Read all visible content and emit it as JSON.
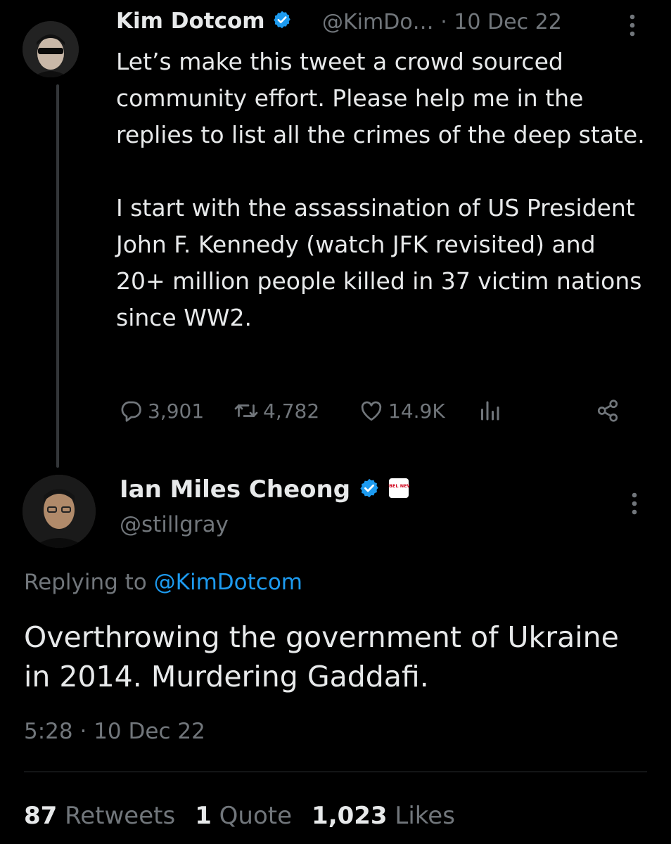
{
  "parent_tweet": {
    "author_name": "Kim Dotcom",
    "handle": "@KimDo…",
    "separator": "·",
    "date": "10 Dec 22",
    "text_paragraphs": [
      "Let’s make this tweet a crowd sourced community effort. Please help me in the replies to list all the crimes of the deep state.",
      "I start with the assassination of US President John F. Kennedy (watch JFK revisited) and 20+ million people killed in 37 victim nations since WW2."
    ],
    "actions": {
      "replies": "3,901",
      "retweets": "4,782",
      "likes": "14.9K"
    }
  },
  "reply_tweet": {
    "author_name": "Ian Miles Cheong",
    "handle": "@stillgray",
    "affiliation_badge_text": "REBEL NEWS",
    "replying_label": "Replying to",
    "replying_to": "@KimDotcom",
    "text": "Overthrowing the government of Ukraine in 2014. Murdering Gaddafi.",
    "time": "5:28",
    "separator": "·",
    "date": "10 Dec 22",
    "stats": {
      "retweets_count": "87",
      "retweets_label": "Retweets",
      "quotes_count": "1",
      "quotes_label": "Quote",
      "likes_count": "1,023",
      "likes_label": "Likes"
    }
  },
  "colors": {
    "background": "#000000",
    "text_primary": "#e7e9ea",
    "text_secondary": "#71767b",
    "link_blue": "#1d9bf0",
    "verified_blue": "#1d9bf0",
    "divider": "#2f3336"
  },
  "icons": [
    "verified-badge-icon",
    "more-options-icon",
    "reply-icon",
    "retweet-icon",
    "like-icon",
    "views-icon",
    "share-icon"
  ]
}
